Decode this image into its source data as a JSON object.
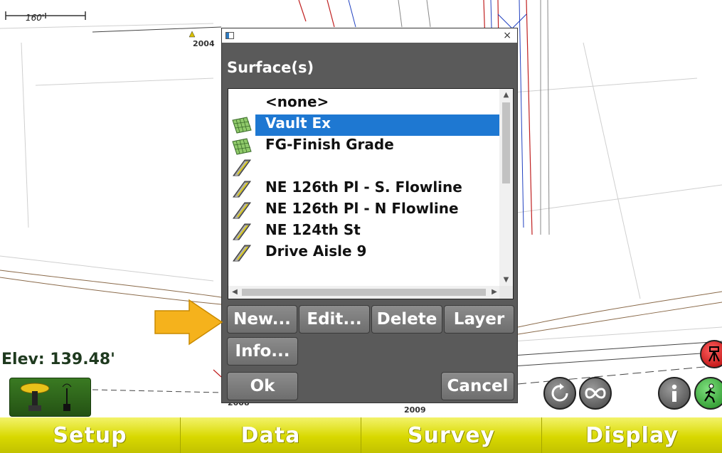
{
  "map": {
    "scale_label": "160'",
    "labels": [
      "2004",
      "2008",
      "2009"
    ],
    "elevation": "Elev: 139.48'"
  },
  "dialog": {
    "title": "Surface(s)",
    "close_glyph": "×",
    "items": [
      {
        "label": "<none>",
        "icon": "none",
        "selected": false
      },
      {
        "label": "Vault Ex",
        "icon": "surface-grid-icon",
        "selected": true
      },
      {
        "label": "FG-Finish Grade",
        "icon": "surface-grid-icon",
        "selected": false
      },
      {
        "label": "",
        "icon": "road-icon",
        "selected": false
      },
      {
        "label": "NE 126th Pl - S. Flowline",
        "icon": "road-icon",
        "selected": false
      },
      {
        "label": "NE 126th Pl - N Flowline",
        "icon": "road-icon",
        "selected": false
      },
      {
        "label": "NE 124th St",
        "icon": "road-icon",
        "selected": false
      },
      {
        "label": "Drive Aisle 9",
        "icon": "road-icon",
        "selected": false
      }
    ],
    "buttons": {
      "new": "New...",
      "edit": "Edit...",
      "delete": "Delete",
      "layer": "Layer",
      "info": "Info...",
      "ok": "Ok",
      "cancel": "Cancel"
    }
  },
  "toolbar": {
    "icons": [
      "rotate-icon",
      "infinity-icon",
      "info-icon",
      "walk-icon"
    ]
  },
  "navbar": {
    "setup": "Setup",
    "data": "Data",
    "survey": "Survey",
    "display": "Display"
  },
  "colors": {
    "selection": "#1e78d2",
    "dialog_bg": "#5a5a5a",
    "navbar": "#d8d800",
    "arrow": "#f5b21c"
  }
}
